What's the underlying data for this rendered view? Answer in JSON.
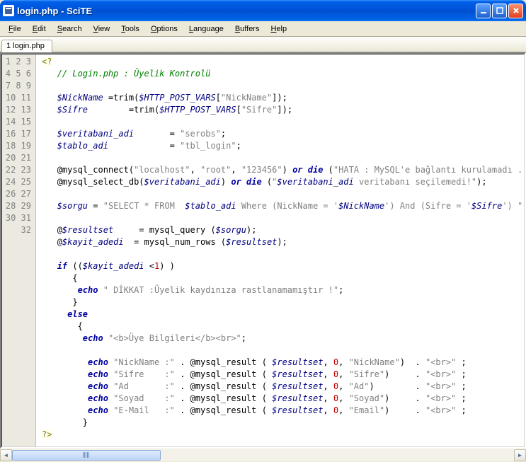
{
  "title": "login.php - SciTE",
  "menu": [
    "File",
    "Edit",
    "Search",
    "View",
    "Tools",
    "Options",
    "Language",
    "Buffers",
    "Help"
  ],
  "tab": "1 login.php",
  "lines": 32,
  "code": {
    "l1": "<?",
    "l2_comment": "// Login.php : Üyelik Kontrolü",
    "l4_v1": "$NickName",
    "l4_fn": "trim",
    "l4_v2": "$HTTP_POST_VARS",
    "l4_s": "\"NickName\"",
    "l5_v1": "$Sifre",
    "l5_s": "\"Sifre\"",
    "l7_v": "$veritabani_adi",
    "l7_s": "\"serobs\"",
    "l8_v": "$tablo_adi",
    "l8_s": "\"tbl_login\"",
    "l10_fn": "mysql_connect",
    "l10_s1": "\"localhost\"",
    "l10_s2": "\"root\"",
    "l10_s3": "\"123456\"",
    "l10_kw": "or die",
    "l10_s4": "\"HATA : MySQL'e bağlantı kurulamadı ...\"",
    "l11_fn": "mysql_select_db",
    "l11_v": "$veritabani_adi",
    "l11_s1": "\"",
    "l11_sv": "$veritabani_adi",
    "l11_s2": " veritabanı seçilemedi!\"",
    "l13_v": "$sorgu",
    "l13_s1": "\"SELECT * FROM  ",
    "l13_sv1": "$tablo_adi",
    "l13_s2": " Where (NickName = '",
    "l13_sv2": "$NickName",
    "l13_s3": "') And (Sifre = '",
    "l13_sv3": "$Sifre",
    "l13_s4": "') \"",
    "l15_v": "$resultset",
    "l15_fn": "mysql_query",
    "l15_v2": "$sorgu",
    "l16_v": "$kayit_adedi",
    "l16_fn": "mysql_num_rows",
    "l16_v2": "$resultset",
    "l18_kw": "if",
    "l18_v": "$kayit_adedi",
    "l18_n": "1",
    "l20_kw": "echo",
    "l20_s": "\" DİKKAT :Üyelik kaydınıza rastlanamamıştır !\"",
    "l22_kw": "else",
    "l24_kw": "echo",
    "l24_s": "\"<b>Üye Bilgileri</b><br>\"",
    "l26_s1": "\"NickName :\"",
    "l26_fn": "mysql_result",
    "l26_v": "$resultset",
    "l26_n": "0",
    "l26_s2": "\"NickName\"",
    "l26_s3": "\"<br>\"",
    "l27_s1": "\"Sifre    :\"",
    "l27_s2": "\"Sifre\"",
    "l28_s1": "\"Ad       :\"",
    "l28_s2": "\"Ad\"",
    "l29_s1": "\"Soyad    :\"",
    "l29_s2": "\"Soyad\"",
    "l30_s1": "\"E-Mail   :\"",
    "l30_s2": "\"Email\"",
    "l32": "?>"
  }
}
